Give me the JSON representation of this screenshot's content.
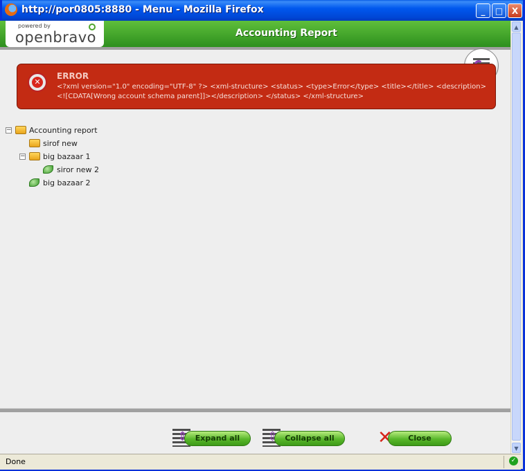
{
  "window": {
    "title": "http://por0805:8880 - Menu - Mozilla Firefox",
    "controls": {
      "minimize": "_",
      "maximize": "□",
      "close": "X"
    }
  },
  "header": {
    "logo_powered": "powered by",
    "logo_brand": "openbravo",
    "title": "Accounting Report"
  },
  "error": {
    "title": "ERROR",
    "message": "<?xml version=\"1.0\" encoding=\"UTF-8\" ?> <xml-structure> <status> <type>Error</type> <title></title> <description><![CDATA[Wrong account schema parent]]></description> </status> </xml-structure>"
  },
  "tree": {
    "root": {
      "label": "Accounting report",
      "toggle": "−",
      "icon": "folder-open-icon"
    },
    "children": [
      {
        "label": "sirof new",
        "icon": "folder-icon"
      },
      {
        "label": "big bazaar 1",
        "toggle": "−",
        "icon": "folder-open-icon"
      },
      {
        "label": "siror new 2",
        "icon": "leaf-icon"
      },
      {
        "label": "big bazaar 2",
        "icon": "leaf-icon"
      }
    ]
  },
  "buttons": {
    "expand_all": "Expand all",
    "collapse_all": "Collapse all",
    "close": "Close"
  },
  "status": {
    "text": "Done",
    "ok": "✓"
  }
}
